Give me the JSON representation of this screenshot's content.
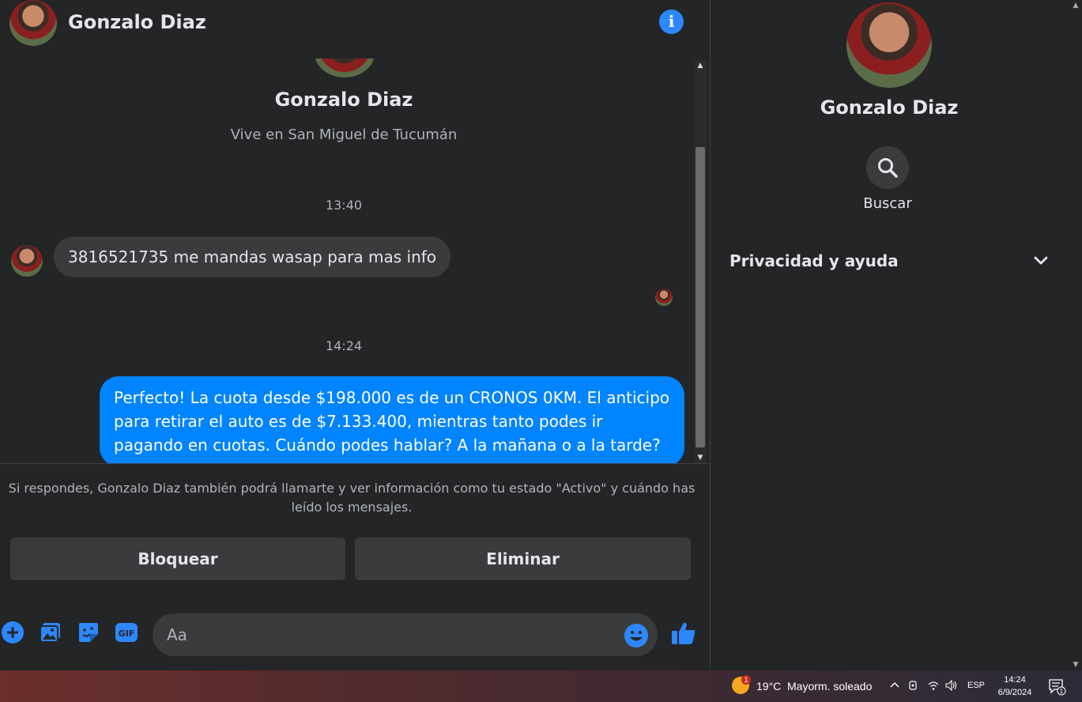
{
  "header": {
    "contact_name": "Gonzalo Diaz"
  },
  "profile": {
    "name": "Gonzalo Diaz",
    "subtitle": "Vive en San Miguel de Tucumán"
  },
  "messages": [
    {
      "time": "13:40",
      "direction": "incoming",
      "text": "3816521735 me mandas wasap para mas info"
    },
    {
      "time": "14:24",
      "direction": "outgoing",
      "text": "Perfecto! La cuota desde $198.000 es de un CRONOS 0KM. El anticipo para retirar el auto es de $7.133.400, mientras tanto podes ir pagando en cuotas. Cuándo podes hablar? A la mañana o a la tarde?"
    }
  ],
  "notice": "Si respondes, Gonzalo Diaz también podrá llamarte y ver información como tu estado \"Activo\" y cuándo has leído los mensajes.",
  "actions": {
    "block_label": "Bloquear",
    "delete_label": "Eliminar"
  },
  "composer": {
    "placeholder": "Aa"
  },
  "sidebar": {
    "name": "Gonzalo Diaz",
    "search_label": "Buscar",
    "privacy_label": "Privacidad y ayuda"
  },
  "taskbar": {
    "weather_badge": "1",
    "temperature": "19°C",
    "condition": "Mayorm. soleado",
    "language": "ESP",
    "time": "14:24",
    "date": "6/9/2024",
    "notification_count": "1"
  },
  "colors": {
    "accent": "#0084ff",
    "icon_blue": "#2d88ff",
    "panel": "#242526",
    "bubble_in": "#3a3b3c"
  }
}
